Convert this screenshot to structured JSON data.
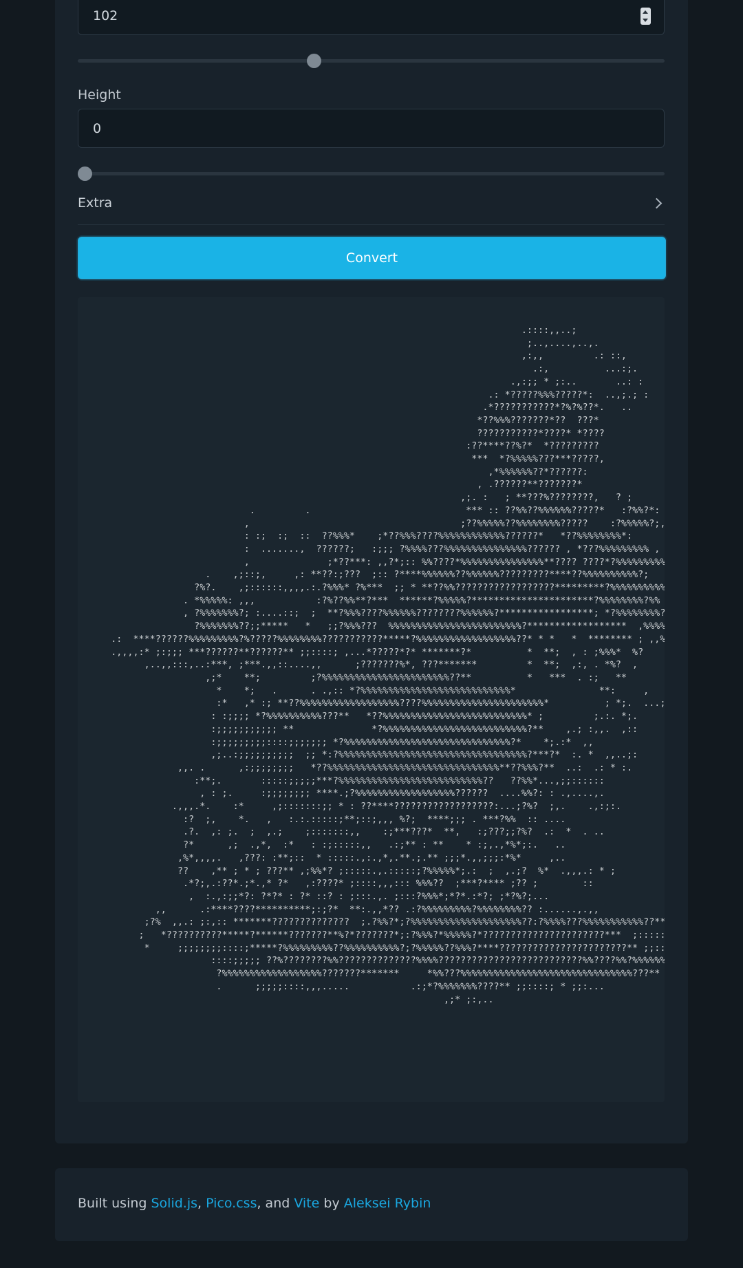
{
  "width_field": {
    "value": "102",
    "slider_value": 102,
    "slider_fraction": 0.4
  },
  "height_field": {
    "label": "Height",
    "value": "0",
    "slider_value": 0,
    "slider_fraction": 0
  },
  "extra": {
    "label": "Extra"
  },
  "convert_button": {
    "label": "Convert"
  },
  "art": {
    "lines": [
      "                                                                              .::::,,..;",
      "                                                                               ;..,....,..,.",
      "                                                                              ,:,,         .: ::,",
      "                                                                                .:,          ...:;.",
      "                                                                            .,:;; * ;:..       ..: :",
      "                                                                        .: *?????%%%?????*:  ..,;.; :",
      "                                                                       .*???????????*?%?%??*.   ..",
      "                                                                      *??%%%???????*??  ???*",
      "                                                                      ???????????*????* *????",
      "                                                                    :??****??%?*  *?????????",
      "                                                                     ***  *?%%%%%???***?????,",
      "                                                                        ,*%%%%%%??*??????:",
      "                                                                      , .??????**???????*",
      "                                                                   ,;. :   ; **???%????????,   ? ;",
      "                             .         .                            *** :: ??%%??%%%%%%?????*   :?%%?*:",
      "                            ,                                      ;??%%%%%??%%%%%%%%?????    :?%%%%%?;,",
      "                            : :;  :;  ::  ??%%%*    ;*??%%%????%%%%%%%%%%%%??????*   *??%%%%%%%%*:",
      "                            :  .......,  ??????;   :;;; ?%%%%???%%%%%%%%%%%%%%%?????? , *???%%%%%%%%% ,",
      "                            ,              ;*??***: ,,?*;:: %%????*%%%%%%%%%%%%%%%**???? ????*?%%%%%%%%%%%*:",
      "                     .    ,;::;,     ,: **??:;???  ;:: ?****%%%%%%??%%%%%%?????????****??%%%%%%%%%%?;",
      "                   ?%?.    ,;::::::,,,,.:.?%%%* ?%***  ;; * **??%%??????????????????*********?%%%%%%%%%%%%*,",
      "                 . *%%%%%: ,,,           :?%??%%**?***  ******?%%%%%?**********************?%%%%%%%%?%%",
      "                 , ?%%%%%%%?; :....::;  ;  **?%%%????%%%%%%????????%%%%%%?*****************; *?%%%%%%%%???",
      "                   ?%%%%%%%??;;*****   *   ;;?%%%???  %%%%%%%%%%%%%%%%%%%%%%%%?******************  ,%%%%%%%%%%%,,,",
      "    .:  ****??????%%%%%%%%%?%?????%%%%%%%%???????????*****?%%%%%%%%%%%%%%%%%%??* * *   *  ******** ; ,,%%%*?%%;",
      "    .,,,,:* ;:;;; ***??????**??????** ;;::::; ,...*?????*?* *******?*          *  **;  , : ;%%%*  %?",
      "          ,..,,:::,..:***, ;***.,,::....,,      ;???????%*, ???*******         *  **;  ,:, . *%?  ,",
      "                     ,;*    **;         ;?%%%%%%%%%%%%%%%%%%%%%%%??**          *   ***  . :;   **",
      "                       *    *;   .      . .,:: *?%%%%%%%%%%%%%%%%%%%%%%%%%%%*               **:     ,",
      "                       :*   ,* :; **??%%%%%%%%%%%%%%%%%%????%%%%%%%%%%%%%%%%%%%%%%*          ; *;.  ...;..",
      "                      : :;;;; *?%%%%%%%%%%???**   *??%%%%%%%%%%%%%%%%%%%%%%%%%%* ;         ;.:. *;.",
      "                      :;;;;;;;;;;; **              *?%%%%%%%%%%%%%%%%%%%%%%%%%%?**    ,.; :,,.  ,::",
      "                      :;;;;;;;;;::::;;;;;;; *?%%%%%%%%%%%%%%%%%%%%%%%%%%%%%%?*    *;.:*  ,,",
      "                      ,;..:;;;;;;;;;;  ;; *:?%%%%%%%%%%%%%%%%%%%%%%%%%%%%%%%%%%?***?*  :. *  ,,..;:",
      "                ,,. .      ,:;;;;;;;;   *??%%%%%%%%%%%%%%%%%%%%%%%%%%%%%%%**??%%%?**  ..:  .: * :.",
      "                   :**;.       :::::;;;;;***?%%%%%%%%%%%%%%%%%%%%%%%%%%??   ??%%*...,;;::::::",
      "                    , : ;.     :;;;;;;;; ****.;?%%%%%%%%%%%%%%%%%%??????  ....%%?: : .,....,.",
      "               .,,,.*.    :*     ,;:::::::;; * : ??****??????????????????:...;?%?  ;,.    .,:;:.",
      "                 :?  ;,    *.   ,   :.:.:::::;**;::;,,, %?;  ****;;; . ***?%%  :: ....",
      "                 .?.  ,: ;.  ;  ,.;    ;:::::::,,    :;***???*  **,   :;???;;?%?  .:  *  . ..",
      "                 ?*      ,;  .,*,  :*   : :;:::::,,   .:;** : **    * :;,.,*%*;:.   ..",
      "                ,%*,,,,.   ,???: :**;::  * :::::.,:.,*,.**.;.** ;;;*.,,;;;:*%*     ,..",
      "                ??    ,** ; * ; ???** ,;%%*? ;:::::.,.:::::;?%%%%%*;.:  ;  ,.;?  %*  .,,,.: * ;",
      "                 .*?;,.:??*.;*.,* ?*   ,:????* ;::::,,,::: %%%??  ;***?**** ;?? ;        ::",
      "                  ,  :.,:;;*?: ?*?* : ?* ::? : ;:::.,. ;:::?%%%*;*?*.:*?; ;*?%?;...",
      "            ,,      .:****????**********;:;?*  **:.,,*?? .:?%%%%%%%%%?%%%%%%%%?? :......,.,,",
      "          ;?%  ,,.: ;:,:: *******??????????????  ;.?%%?*;?%%%%%%%%%%%%%%%%%%%%??:?%%%%???%%%%%%%%%%%??** ;:.",
      "         ;   *??????????*****?******???????**%?*???????*;:?%%%?*%%%%%?*??????????????????????***  ;::::::;;:..",
      "          *     ;;;;;;;;::::;*****?%%%%%%%%%??%%%%%%%%%%?;?%%%%%??%%%?****???????????????????????** ;;::....",
      "                      ::::;;;;; ??%????????%%??????????????%%%%??????????????????????????%%????%%?%%%%%%%%%%??* ;:",
      "                       ?%%%%%%%%%%%%%%%%%%???????*******     *%%???%%%%%%%%%%%%%%%%%%%%%%%%%%%%%%%???** ;:,..",
      "                       .      ;;;;;::::,,,.....           .:;*?%%%%%%%????** ;;::::; * ;;:...",
      "                                                                ,;* ;:,.."
    ]
  },
  "footer": {
    "prefix": "Built using ",
    "link1": "Solid.js",
    "sep1": ", ",
    "link2": "Pico.css",
    "sep2": ", and ",
    "link3": "Vite",
    "by": " by ",
    "author": "Aleksei Rybin"
  }
}
